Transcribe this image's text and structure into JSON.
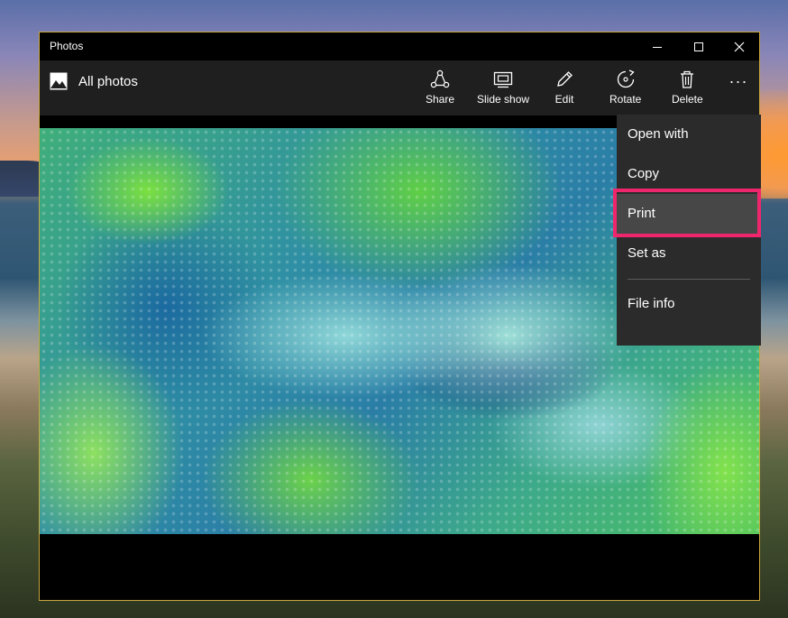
{
  "window": {
    "title": "Photos"
  },
  "toolbar": {
    "all_photos_label": "All photos",
    "share": "Share",
    "slideshow": "Slide show",
    "edit": "Edit",
    "rotate": "Rotate",
    "delete": "Delete",
    "more_icon": "more-ellipsis-icon"
  },
  "menu": {
    "items": [
      "Open with",
      "Copy",
      "Print",
      "Set as",
      "File info"
    ],
    "highlighted": "Print"
  },
  "colors": {
    "accent_highlight": "#f0266c",
    "window_border": "#c9a63d",
    "toolbar_bg": "#1f1f1f",
    "menu_bg": "#2b2b2b"
  }
}
